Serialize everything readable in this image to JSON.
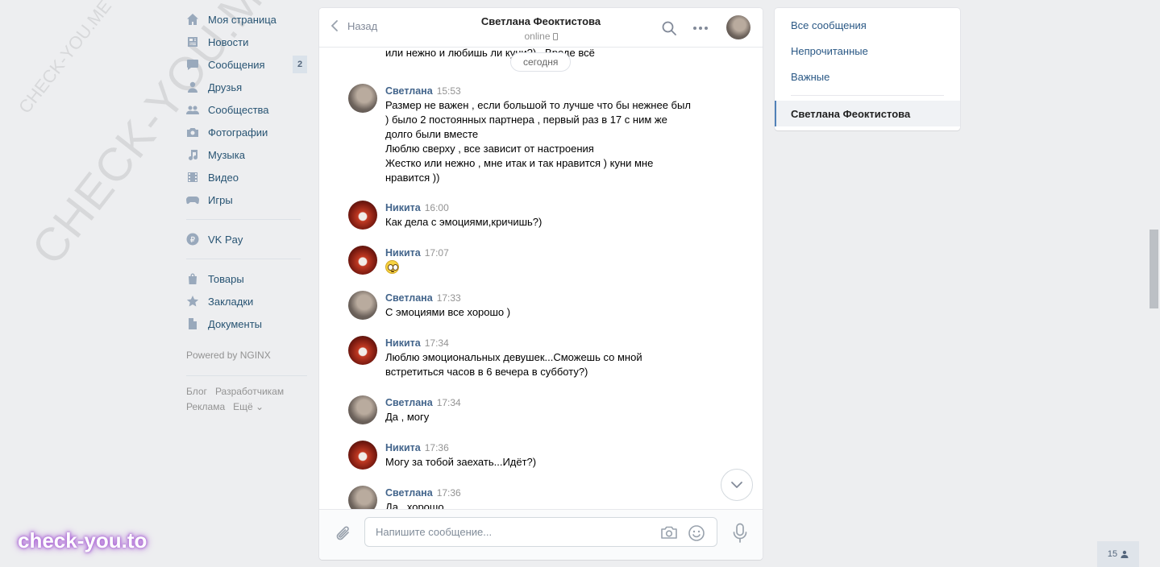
{
  "watermark": {
    "small": "CHECK-YOU.ME",
    "big": "CHECK-YOU.ME",
    "badge": "check-you.to"
  },
  "leftnav": {
    "items": [
      {
        "label": "Моя страница",
        "icon": "home-icon"
      },
      {
        "label": "Новости",
        "icon": "news-icon"
      },
      {
        "label": "Сообщения",
        "icon": "messages-icon",
        "count": "2"
      },
      {
        "label": "Друзья",
        "icon": "friends-icon"
      },
      {
        "label": "Сообщества",
        "icon": "groups-icon"
      },
      {
        "label": "Фотографии",
        "icon": "camera-icon"
      },
      {
        "label": "Музыка",
        "icon": "music-icon"
      },
      {
        "label": "Видео",
        "icon": "video-icon"
      },
      {
        "label": "Игры",
        "icon": "gamepad-icon"
      }
    ],
    "vkpay": "VK Pay",
    "extra": [
      {
        "label": "Товары",
        "icon": "bag-icon"
      },
      {
        "label": "Закладки",
        "icon": "star-icon"
      },
      {
        "label": "Документы",
        "icon": "document-icon"
      }
    ],
    "powered": "Powered by NGINX",
    "footer": {
      "blog": "Блог",
      "dev": "Разработчикам",
      "ads": "Реклама",
      "more": "Ещё ⌄"
    }
  },
  "chat": {
    "back_label": "Назад",
    "peer_name": "Светлана Феоктистова",
    "peer_status": "online",
    "cut_text": "или нежно и любишь ли куни?) . Вроде всё",
    "date_pill": "сегодня",
    "messages": [
      {
        "author": "Светлана",
        "time": "15:53",
        "text": "Размер не важен , если большой то лучше что бы нежнее был\n) было 2 постоянных партнера , первый раз в 17 с ним же\nдолго были вместе\nЛюблю сверху , все зависит от настроения\nЖестко или нежно , мне итак и так нравится ) куни мне\nнравится ))"
      },
      {
        "author": "Никита",
        "time": "16:00",
        "text": "Как дела с эмоциями,кричишь?)"
      },
      {
        "author": "Никита",
        "time": "17:07",
        "text": ""
      },
      {
        "author": "Светлана",
        "time": "17:33",
        "text": "С эмоциями все хорошо )"
      },
      {
        "author": "Никита",
        "time": "17:34",
        "text": "Люблю эмоциональных девушек...Сможешь со мной\nвстретиться часов в 6 вечера в субботу?)"
      },
      {
        "author": "Светлана",
        "time": "17:34",
        "text": "Да , могу"
      },
      {
        "author": "Никита",
        "time": "17:36",
        "text": "Могу за тобой заехать...Идёт?)"
      },
      {
        "author": "Светлана",
        "time": "17:36",
        "text": "Да , хорошо"
      }
    ],
    "composer_placeholder": "Напишите сообщение..."
  },
  "rightpanel": {
    "all": "Все сообщения",
    "unread": "Непрочитанные",
    "important": "Важные",
    "active_chat": "Светлана Феоктистова"
  },
  "online_count": "15"
}
